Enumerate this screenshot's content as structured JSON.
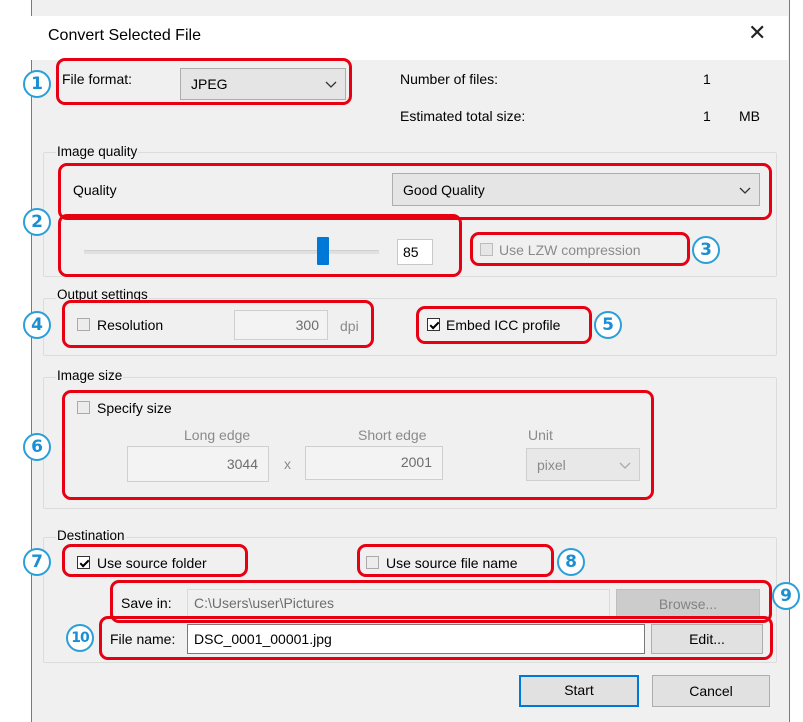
{
  "dialog": {
    "title": "Convert Selected File"
  },
  "format": {
    "label": "File format:",
    "value": "JPEG"
  },
  "info": {
    "files_label": "Number of files:",
    "files_value": "1",
    "size_label": "Estimated total size:",
    "size_value": "1",
    "size_unit": "MB"
  },
  "image_quality": {
    "legend": "Image quality",
    "quality_label": "Quality",
    "quality_value": "Good Quality",
    "slider_value": "85",
    "slider_fraction": 0.85,
    "lzw_label": "Use LZW compression"
  },
  "output": {
    "legend": "Output settings",
    "resolution_label": "Resolution",
    "resolution_value": "300",
    "resolution_unit": "dpi",
    "icc_label": "Embed ICC profile"
  },
  "image_size": {
    "legend": "Image size",
    "specify_label": "Specify size",
    "long_label": "Long edge",
    "long_value": "3044",
    "times": "x",
    "short_label": "Short edge",
    "short_value": "2001",
    "unit_label": "Unit",
    "unit_value": "pixel"
  },
  "destination": {
    "legend": "Destination",
    "source_folder_label": "Use source folder",
    "source_name_label": "Use source file name",
    "save_in_label": "Save in:",
    "save_in_value": "C:\\Users\\user\\Pictures",
    "browse_label": "Browse...",
    "file_name_label": "File name:",
    "file_name_value": "DSC_0001_00001.jpg",
    "edit_label": "Edit..."
  },
  "buttons": {
    "start": "Start",
    "cancel": "Cancel"
  },
  "callouts": [
    "1",
    "2",
    "3",
    "4",
    "5",
    "6",
    "7",
    "8",
    "9",
    "10"
  ],
  "colors": {
    "callout_box": "#e60012",
    "callout_number": "#1b8fd0",
    "accent": "#0078d7"
  }
}
